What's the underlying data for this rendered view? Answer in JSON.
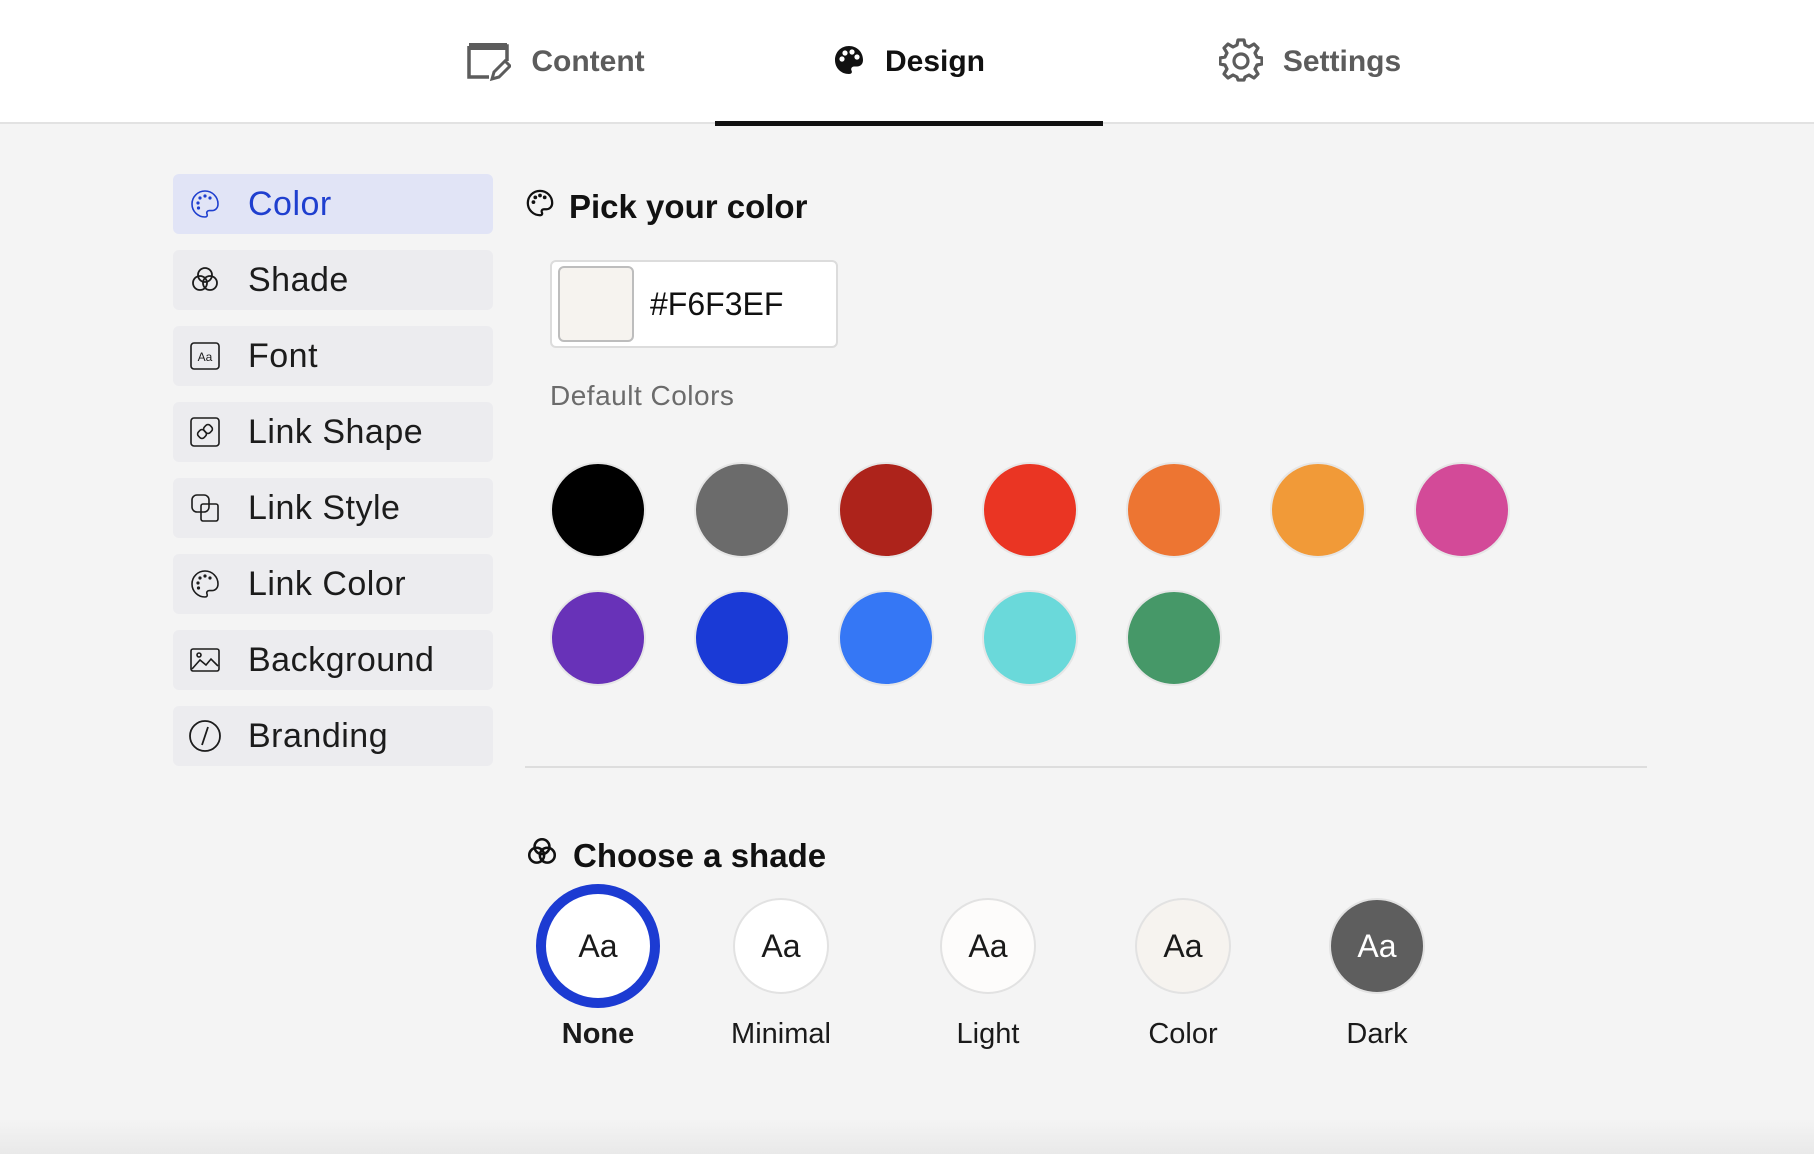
{
  "tabs": [
    {
      "label": "Content",
      "icon": "edit-window-icon",
      "active": false
    },
    {
      "label": "Design",
      "icon": "palette-icon",
      "active": true
    },
    {
      "label": "Settings",
      "icon": "gear-icon",
      "active": false
    }
  ],
  "sidebar": {
    "items": [
      {
        "label": "Color",
        "icon": "palette-outline-icon",
        "active": true
      },
      {
        "label": "Shade",
        "icon": "venn-circles-icon"
      },
      {
        "label": "Font",
        "icon": "font-aa-icon"
      },
      {
        "label": "Link Shape",
        "icon": "link-square-icon"
      },
      {
        "label": "Link Style",
        "icon": "overlap-squares-icon"
      },
      {
        "label": "Link Color",
        "icon": "palette-outline-icon"
      },
      {
        "label": "Background",
        "icon": "image-icon"
      },
      {
        "label": "Branding",
        "icon": "slash-circle-icon"
      }
    ]
  },
  "color_section": {
    "title": "Pick your color",
    "hex_value": "#F6F3EF",
    "default_colors_label": "Default Colors",
    "default_colors": [
      "#000000",
      "#6b6b6b",
      "#ad231b",
      "#ea3523",
      "#ed7532",
      "#f19a38",
      "#d34a98",
      "#6832b8",
      "#1a3ad6",
      "#3577f5",
      "#6ad9da",
      "#469868"
    ]
  },
  "shade_section": {
    "title": "Choose a shade",
    "sample_text": "Aa",
    "options": [
      {
        "label": "None",
        "selected": true,
        "bg": "#ffffff",
        "fg": "#1a1a1a"
      },
      {
        "label": "Minimal",
        "bg": "#ffffff",
        "fg": "#1a1a1a"
      },
      {
        "label": "Light",
        "bg": "#fdfcfb",
        "fg": "#1a1a1a"
      },
      {
        "label": "Color",
        "bg": "#f6f3ef",
        "fg": "#1a1a1a"
      },
      {
        "label": "Dark",
        "bg": "#5e5e5e",
        "fg": "#ffffff"
      }
    ]
  },
  "accent_color": "#1f3fcf"
}
